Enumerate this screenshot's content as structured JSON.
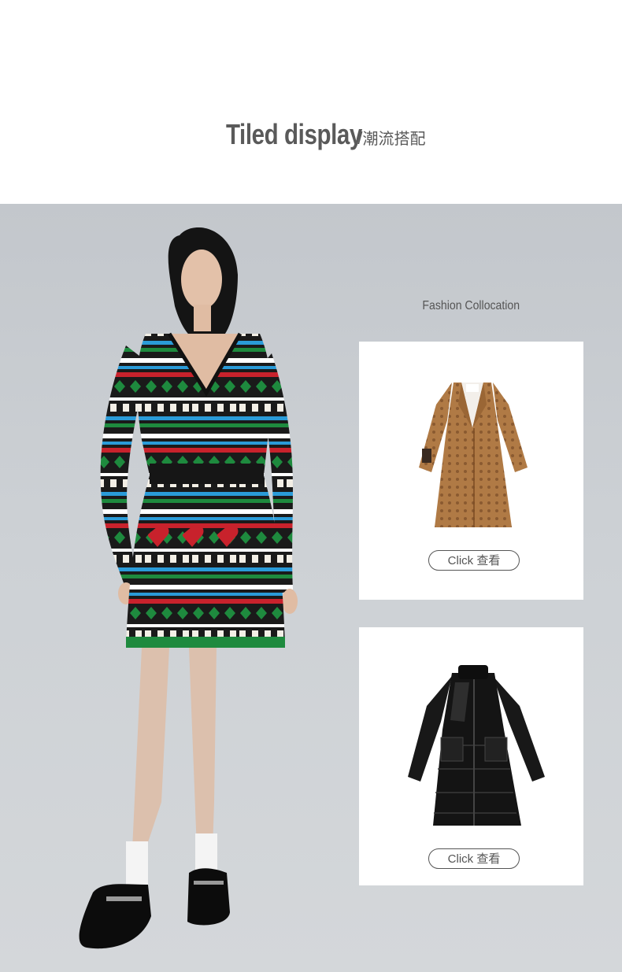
{
  "header": {
    "title_en": "Tiled  display",
    "separator": "/",
    "title_cn": "潮流搭配"
  },
  "section": {
    "label": "Fashion Collocation"
  },
  "products": [
    {
      "name": "camel-monogram-coat",
      "button_label": "Click 查看"
    },
    {
      "name": "black-down-coat",
      "button_label": "Click 查看"
    }
  ],
  "colors": {
    "title": "#5a5a5a",
    "stage_bg": "#c9cdd1",
    "coat_camel": "#b07a45",
    "coat_black": "#141414",
    "dress_green": "#1e8a3e",
    "dress_red": "#c8222c",
    "dress_blue": "#2a9bd8"
  }
}
